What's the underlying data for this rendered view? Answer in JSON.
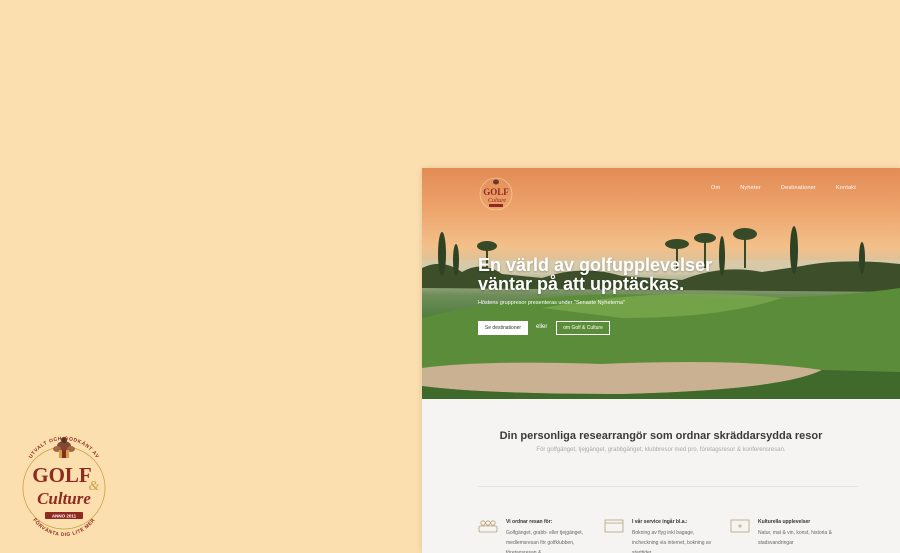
{
  "logo": {
    "top_arc": "UTVALT OCH GODKÄNT AV",
    "word1": "GOLF",
    "word2": "Culture",
    "amp": "&",
    "ribbon": "ANNO 2011",
    "bottom_arc": "FÖRVÄNTA DIG LITE MER"
  },
  "site": {
    "nav": [
      "Om",
      "Nyheter",
      "Destinationer",
      "Kontakt"
    ],
    "hero": {
      "title_line1": "En värld av golfupplevelser",
      "title_line2": "väntar på att upptäckas.",
      "subtitle": "Höstens gruppresor presenteras under \"Senaste Nyheterna\"",
      "primary_button": "Se destinationer",
      "or_text": "eller",
      "secondary_button": "om Golf & Culture"
    },
    "intro": {
      "title": "Din personliga researrangör som ordnar skräddarsydda resor",
      "subtitle": "För golfgänget, tjejgänget, grabbgänget, klubbresor med pro, företagsresor & konferensresan."
    },
    "features": [
      {
        "icon": "people-icon",
        "title": "Vi ordnar resan för:",
        "lines": [
          "Golfgänget, grabb- eller tjejgänget,",
          "medlemsresan för golfklubben, företagsresan &"
        ]
      },
      {
        "icon": "calendar-icon",
        "title": "I vår service ingår bl.a.:",
        "lines": [
          "Bokning av flyg inkl bagage,",
          "incheckning via internet, bokning av starttider,"
        ]
      },
      {
        "icon": "plus-card-icon",
        "title": "Kulturella upplevelser",
        "lines": [
          "Natur, mat & vin, konst, historia &",
          "stadsvandringar"
        ]
      }
    ]
  },
  "colors": {
    "background": "#fbdfae",
    "logo_red": "#8e2a1f",
    "logo_gold": "#c9a24a"
  }
}
